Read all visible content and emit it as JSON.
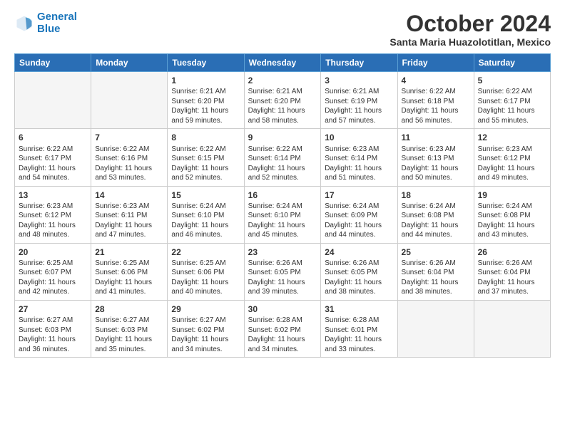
{
  "header": {
    "logo_line1": "General",
    "logo_line2": "Blue",
    "month": "October 2024",
    "location": "Santa Maria Huazolotitlan, Mexico"
  },
  "days_of_week": [
    "Sunday",
    "Monday",
    "Tuesday",
    "Wednesday",
    "Thursday",
    "Friday",
    "Saturday"
  ],
  "weeks": [
    [
      {
        "day": "",
        "info": ""
      },
      {
        "day": "",
        "info": ""
      },
      {
        "day": "1",
        "info": "Sunrise: 6:21 AM\nSunset: 6:20 PM\nDaylight: 11 hours and 59 minutes."
      },
      {
        "day": "2",
        "info": "Sunrise: 6:21 AM\nSunset: 6:20 PM\nDaylight: 11 hours and 58 minutes."
      },
      {
        "day": "3",
        "info": "Sunrise: 6:21 AM\nSunset: 6:19 PM\nDaylight: 11 hours and 57 minutes."
      },
      {
        "day": "4",
        "info": "Sunrise: 6:22 AM\nSunset: 6:18 PM\nDaylight: 11 hours and 56 minutes."
      },
      {
        "day": "5",
        "info": "Sunrise: 6:22 AM\nSunset: 6:17 PM\nDaylight: 11 hours and 55 minutes."
      }
    ],
    [
      {
        "day": "6",
        "info": "Sunrise: 6:22 AM\nSunset: 6:17 PM\nDaylight: 11 hours and 54 minutes."
      },
      {
        "day": "7",
        "info": "Sunrise: 6:22 AM\nSunset: 6:16 PM\nDaylight: 11 hours and 53 minutes."
      },
      {
        "day": "8",
        "info": "Sunrise: 6:22 AM\nSunset: 6:15 PM\nDaylight: 11 hours and 52 minutes."
      },
      {
        "day": "9",
        "info": "Sunrise: 6:22 AM\nSunset: 6:14 PM\nDaylight: 11 hours and 52 minutes."
      },
      {
        "day": "10",
        "info": "Sunrise: 6:23 AM\nSunset: 6:14 PM\nDaylight: 11 hours and 51 minutes."
      },
      {
        "day": "11",
        "info": "Sunrise: 6:23 AM\nSunset: 6:13 PM\nDaylight: 11 hours and 50 minutes."
      },
      {
        "day": "12",
        "info": "Sunrise: 6:23 AM\nSunset: 6:12 PM\nDaylight: 11 hours and 49 minutes."
      }
    ],
    [
      {
        "day": "13",
        "info": "Sunrise: 6:23 AM\nSunset: 6:12 PM\nDaylight: 11 hours and 48 minutes."
      },
      {
        "day": "14",
        "info": "Sunrise: 6:23 AM\nSunset: 6:11 PM\nDaylight: 11 hours and 47 minutes."
      },
      {
        "day": "15",
        "info": "Sunrise: 6:24 AM\nSunset: 6:10 PM\nDaylight: 11 hours and 46 minutes."
      },
      {
        "day": "16",
        "info": "Sunrise: 6:24 AM\nSunset: 6:10 PM\nDaylight: 11 hours and 45 minutes."
      },
      {
        "day": "17",
        "info": "Sunrise: 6:24 AM\nSunset: 6:09 PM\nDaylight: 11 hours and 44 minutes."
      },
      {
        "day": "18",
        "info": "Sunrise: 6:24 AM\nSunset: 6:08 PM\nDaylight: 11 hours and 44 minutes."
      },
      {
        "day": "19",
        "info": "Sunrise: 6:24 AM\nSunset: 6:08 PM\nDaylight: 11 hours and 43 minutes."
      }
    ],
    [
      {
        "day": "20",
        "info": "Sunrise: 6:25 AM\nSunset: 6:07 PM\nDaylight: 11 hours and 42 minutes."
      },
      {
        "day": "21",
        "info": "Sunrise: 6:25 AM\nSunset: 6:06 PM\nDaylight: 11 hours and 41 minutes."
      },
      {
        "day": "22",
        "info": "Sunrise: 6:25 AM\nSunset: 6:06 PM\nDaylight: 11 hours and 40 minutes."
      },
      {
        "day": "23",
        "info": "Sunrise: 6:26 AM\nSunset: 6:05 PM\nDaylight: 11 hours and 39 minutes."
      },
      {
        "day": "24",
        "info": "Sunrise: 6:26 AM\nSunset: 6:05 PM\nDaylight: 11 hours and 38 minutes."
      },
      {
        "day": "25",
        "info": "Sunrise: 6:26 AM\nSunset: 6:04 PM\nDaylight: 11 hours and 38 minutes."
      },
      {
        "day": "26",
        "info": "Sunrise: 6:26 AM\nSunset: 6:04 PM\nDaylight: 11 hours and 37 minutes."
      }
    ],
    [
      {
        "day": "27",
        "info": "Sunrise: 6:27 AM\nSunset: 6:03 PM\nDaylight: 11 hours and 36 minutes."
      },
      {
        "day": "28",
        "info": "Sunrise: 6:27 AM\nSunset: 6:03 PM\nDaylight: 11 hours and 35 minutes."
      },
      {
        "day": "29",
        "info": "Sunrise: 6:27 AM\nSunset: 6:02 PM\nDaylight: 11 hours and 34 minutes."
      },
      {
        "day": "30",
        "info": "Sunrise: 6:28 AM\nSunset: 6:02 PM\nDaylight: 11 hours and 34 minutes."
      },
      {
        "day": "31",
        "info": "Sunrise: 6:28 AM\nSunset: 6:01 PM\nDaylight: 11 hours and 33 minutes."
      },
      {
        "day": "",
        "info": ""
      },
      {
        "day": "",
        "info": ""
      }
    ]
  ]
}
